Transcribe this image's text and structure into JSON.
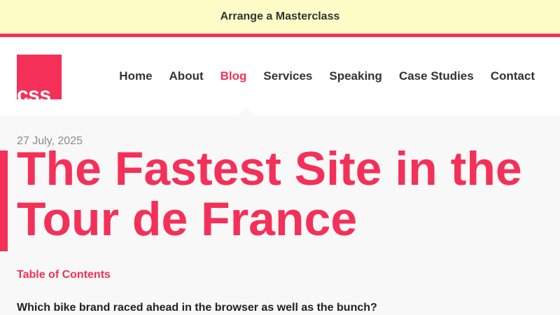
{
  "banner": {
    "cta_label": "Arrange a Masterclass"
  },
  "colors": {
    "accent": "#f43059",
    "banner_bg": "#fefdc8",
    "text": "#333333"
  },
  "header": {
    "logo_text": "css",
    "nav": [
      {
        "label": "Home",
        "active": false
      },
      {
        "label": "About",
        "active": false
      },
      {
        "label": "Blog",
        "active": true
      },
      {
        "label": "Services",
        "active": false
      },
      {
        "label": "Speaking",
        "active": false
      },
      {
        "label": "Case Studies",
        "active": false
      },
      {
        "label": "Contact",
        "active": false
      }
    ]
  },
  "post": {
    "date": "27 July, 2025",
    "title": "The Fastest Site in the Tour de France",
    "toc_label": "Table of Contents",
    "lead": "Which bike brand raced ahead in the browser as well as the bunch?"
  }
}
